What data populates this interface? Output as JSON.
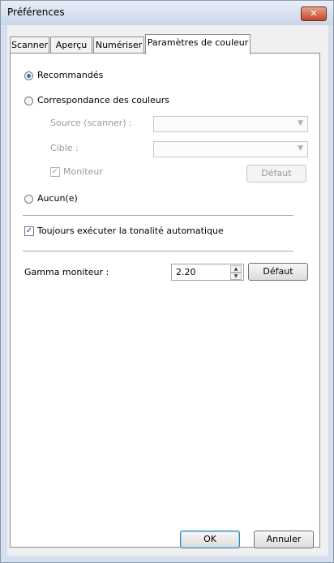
{
  "window": {
    "title": "Préférences",
    "close_label": "✕"
  },
  "tabs": [
    {
      "label": "Scanner"
    },
    {
      "label": "Aperçu"
    },
    {
      "label": "Numériser"
    },
    {
      "label": "Paramètres de couleur"
    }
  ],
  "color_settings": {
    "recommended_label": "Recommandés",
    "matching_label": "Correspondance des couleurs",
    "source_label": "Source (scanner) :",
    "source_value": "",
    "target_label": "Cible :",
    "target_value": "",
    "monitor_label": "Moniteur",
    "monitor_checked": true,
    "default_label": "Défaut",
    "none_label": "Aucun(e)",
    "auto_tone_label": "Toujours exécuter la tonalité automatique",
    "auto_tone_checked": true,
    "gamma_label": "Gamma moniteur :",
    "gamma_value": "2.20",
    "gamma_default_label": "Défaut",
    "selected_option": "Recommandés"
  },
  "footer": {
    "ok_label": "OK",
    "cancel_label": "Annuler"
  },
  "icons": {
    "checkmark": "✓",
    "dropdown_arrow": "▼",
    "spin_up": "▲",
    "spin_down": "▼"
  }
}
